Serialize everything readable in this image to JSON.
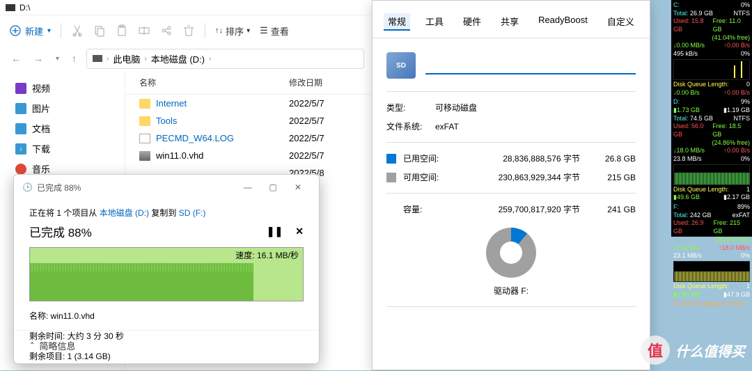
{
  "explorer": {
    "title": "D:\\",
    "new_btn": "新建",
    "sort": "排序",
    "view": "查看",
    "crumb1": "此电脑",
    "crumb2": "本地磁盘 (D:)",
    "sidebar": [
      {
        "label": "视频",
        "color": "#7b39c7"
      },
      {
        "label": "图片",
        "color": "#3b97d3"
      },
      {
        "label": "文档",
        "color": "#3b97d3"
      },
      {
        "label": "下载",
        "color": "#3b97d3"
      },
      {
        "label": "音乐",
        "color": "#e14a3b"
      }
    ],
    "headers": {
      "name": "名称",
      "date": "修改日期"
    },
    "files": [
      {
        "name": "Internet",
        "type": "folder",
        "link": true,
        "date": "2022/5/7"
      },
      {
        "name": "Tools",
        "type": "folder",
        "link": true,
        "date": "2022/5/7"
      },
      {
        "name": "PECMD_W64.LOG",
        "type": "text",
        "link": true,
        "date": "2022/5/7"
      },
      {
        "name": "win11.0.vhd",
        "type": "disk",
        "link": false,
        "date": "2022/5/7"
      },
      {
        "name": "",
        "type": "",
        "link": false,
        "date": "2022/5/8"
      }
    ]
  },
  "copy": {
    "title": "已完成 88%",
    "line_prefix": "正在将 1 个项目从 ",
    "src": "本地磁盘 (D:)",
    "action": " 复制到 ",
    "dst": "SD (F:)",
    "progress": "已完成 88%",
    "speed": "速度: 16.1 MB/秒",
    "name_label": "名称: ",
    "name_value": "win11.0.vhd",
    "time_label": "剩余时间: ",
    "time_value": "大约 3 分 30 秒",
    "items_label": "剩余项目: ",
    "items_value": "1 (3.14 GB)",
    "simple": "简略信息"
  },
  "props": {
    "tabs": [
      "常规",
      "工具",
      "硬件",
      "共享",
      "ReadyBoost",
      "自定义"
    ],
    "type_label": "类型:",
    "type_value": "可移动磁盘",
    "fs_label": "文件系统:",
    "fs_value": "exFAT",
    "used_label": "已用空间:",
    "used_bytes": "28,836,888,576 字节",
    "used_gb": "26.8 GB",
    "free_label": "可用空间:",
    "free_bytes": "230,863,929,344 字节",
    "free_gb": "215 GB",
    "cap_label": "容量:",
    "cap_bytes": "259,700,817,920 字节",
    "cap_gb": "241 GB",
    "drive": "驱动器 F:"
  },
  "monitor": {
    "c": {
      "title": "C:",
      "pct": "0%",
      "total_l": "Total:",
      "total": "26.9 GB",
      "fs": "NTFS",
      "used_l": "Used:",
      "used": "15.8 GB",
      "free_l": "Free:",
      "free": "11.0 GB",
      "pct_free": "(41.04% free)",
      "read": "0.00 MB/s",
      "write": "0.00 B/s",
      "rate": "495 kB/s",
      "rate2": "0%",
      "dql": "Disk Queue Length:",
      "dqlv": "0",
      "dqla": "0.00 B/s",
      "dqlb": "0.00 B/s"
    },
    "d": {
      "title": "D:",
      "pct": "9%",
      "total_l": "Total:",
      "total": "1.73 GB",
      "other": "1.19 GB",
      "total2_l": "Total:",
      "total2": "74.5 GB",
      "fs": "NTFS",
      "used_l": "Used:",
      "used": "56.0 GB",
      "free_l": "Free:",
      "free": "18.5 GB",
      "pct_free": "(24.86% free)",
      "read": "18.0 MB/s",
      "write": "0.00 B/s",
      "rate": "23.8 MB/s",
      "rate2": "0%",
      "dql": "Disk Queue Length:",
      "dqlv": "1",
      "dqla": "49.6 GB",
      "dqlb": "2.17 GB"
    },
    "f": {
      "title": "F:",
      "pct": "89%",
      "total_l": "Total:",
      "total": "242 GB",
      "fs": "exFAT",
      "used_l": "Used:",
      "used": "26.9 GB",
      "free_l": "Free:",
      "free": "215 GB",
      "pct_free": "(88.9% free)",
      "read": "0.00 B/s",
      "write": "18.0 MB/s",
      "rate": "23.1 MB/s",
      "rate2": "0%",
      "dql": "Disk Queue Length:",
      "dqlv": "1",
      "dqla": "1.88 MB",
      "dqlb": "47.9 GB"
    },
    "footer": "© 2021 by Igogo  #1 v16.9"
  },
  "watermark": "什么值得买"
}
